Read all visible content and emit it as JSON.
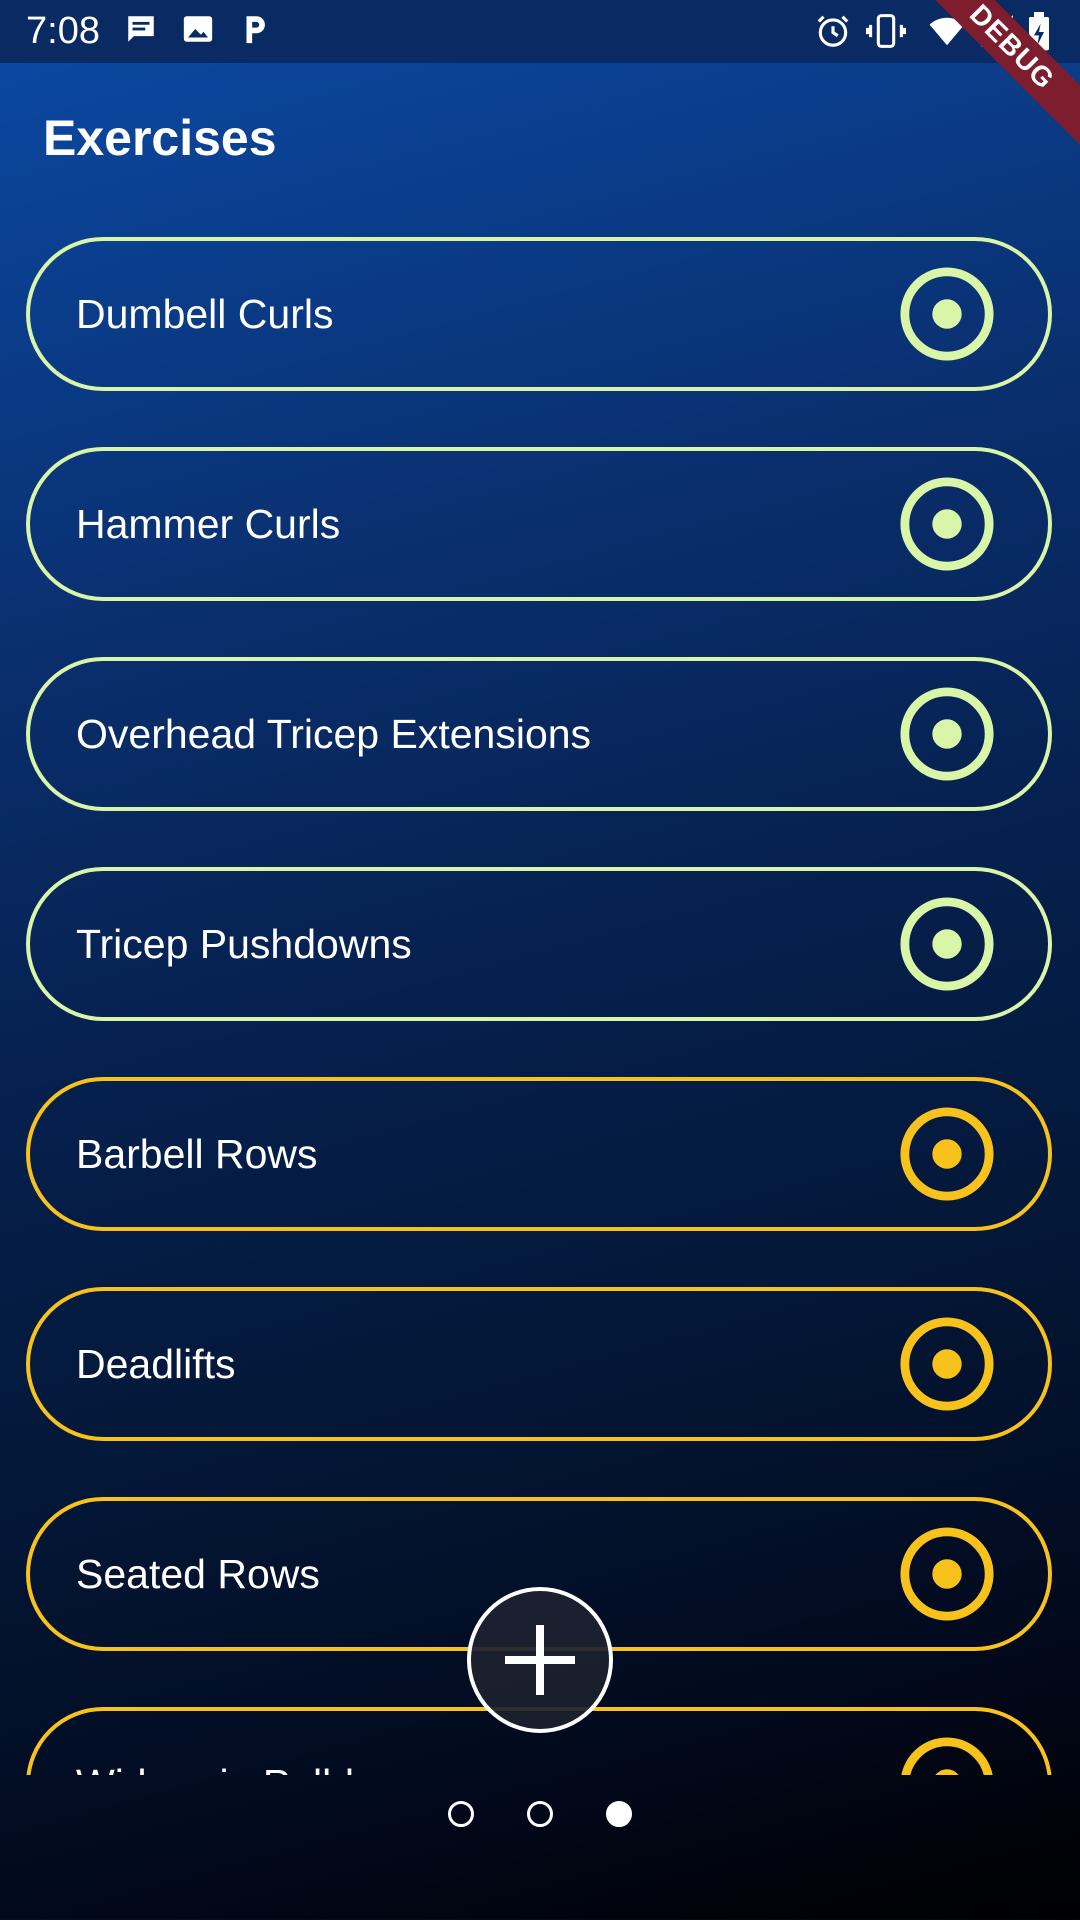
{
  "status_bar": {
    "time": "7:08",
    "left_icons": [
      "message-icon",
      "image-icon",
      "parking-icon"
    ],
    "right_icons": [
      "alarm-icon",
      "vibrate-icon",
      "wifi-icon",
      "signal-icon",
      "battery-icon"
    ],
    "debug_banner": "DEBUG"
  },
  "header": {
    "title": "Exercises"
  },
  "colors": {
    "group_a": "#d8f5a8",
    "group_b": "#f8c21c"
  },
  "exercises": [
    {
      "name": "Dumbell Curls",
      "group": "a"
    },
    {
      "name": "Hammer Curls",
      "group": "a"
    },
    {
      "name": "Overhead Tricep Extensions",
      "group": "a"
    },
    {
      "name": "Tricep Pushdowns",
      "group": "a"
    },
    {
      "name": "Barbell Rows",
      "group": "b"
    },
    {
      "name": "Deadlifts",
      "group": "b"
    },
    {
      "name": "Seated Rows",
      "group": "b"
    },
    {
      "name": "Wide-grip Pulldowns",
      "group": "b"
    }
  ],
  "fab": {
    "icon": "plus-icon"
  },
  "pager": {
    "count": 3,
    "active_index": 2
  }
}
